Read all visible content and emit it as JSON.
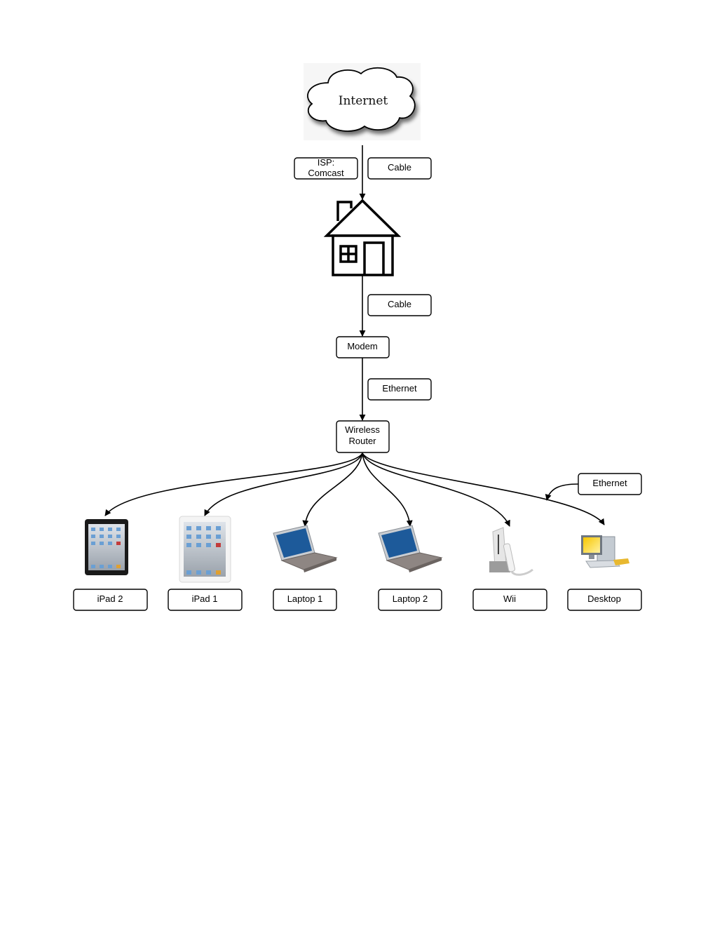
{
  "diagram": {
    "type": "home network topology",
    "nodes": {
      "internet": {
        "label": "Internet",
        "icon": "cloud-icon"
      },
      "house": {
        "icon": "house-icon"
      },
      "modem": {
        "label": "Modem"
      },
      "router": {
        "line1": "Wireless",
        "line2": "Router"
      }
    },
    "edge_labels": {
      "isp": {
        "line1": "ISP:",
        "line2": "Comcast"
      },
      "internet_to_house": "Cable",
      "house_to_modem": "Cable",
      "modem_to_router": "Ethernet",
      "router_to_desktop": "Ethernet"
    },
    "devices": [
      {
        "label": "iPad 2",
        "icon": "ipad-black-icon"
      },
      {
        "label": "iPad 1",
        "icon": "ipad-white-icon"
      },
      {
        "label": "Laptop 1",
        "icon": "laptop-icon"
      },
      {
        "label": "Laptop 2",
        "icon": "laptop-icon"
      },
      {
        "label": "Wii",
        "icon": "wii-console-icon"
      },
      {
        "label": "Desktop",
        "icon": "desktop-computer-icon"
      }
    ]
  }
}
